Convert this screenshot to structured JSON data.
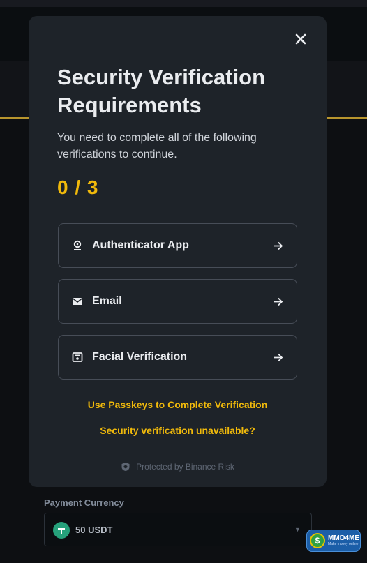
{
  "modal": {
    "title": "Security Verification Requirements",
    "description": "You need to complete all of the following verifications to continue.",
    "progress": "0 / 3",
    "methods": [
      {
        "label": "Authenticator App",
        "icon": "authenticator-icon"
      },
      {
        "label": "Email",
        "icon": "email-icon"
      },
      {
        "label": "Facial Verification",
        "icon": "face-id-icon"
      }
    ],
    "passkeys_link": "Use Passkeys to Complete Verification",
    "unavailable_link": "Security verification unavailable?",
    "footer": "Protected by Binance Risk"
  },
  "background": {
    "payment_currency_label": "Payment Currency",
    "payment_currency_value": "50 USDT"
  },
  "watermark": {
    "title": "MMO4ME",
    "subtitle": "Make money online"
  },
  "colors": {
    "accent": "#f0b90b",
    "modal_bg": "#1e2329",
    "page_bg": "#0b0e11",
    "border": "#474d57"
  }
}
